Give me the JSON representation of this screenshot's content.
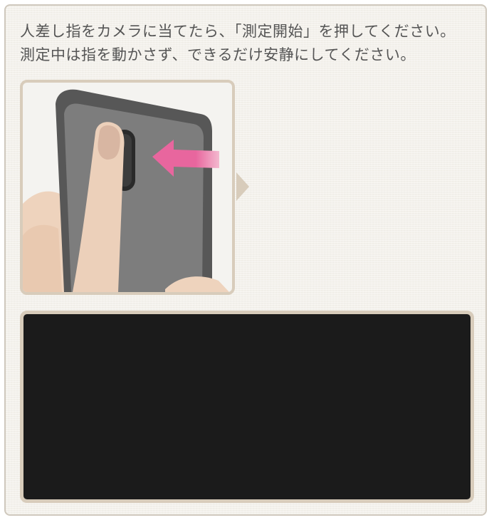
{
  "instruction": {
    "line1": "人差し指をカメラに当てたら、「測定開始」を押してください。",
    "line2": "測定中は指を動かさず、できるだけ安静にしてください。"
  },
  "illustration": {
    "icon": "finger-on-camera-icon",
    "arrow_color": "#e8669e"
  },
  "camera_view": {
    "background": "#1b1b1b"
  }
}
